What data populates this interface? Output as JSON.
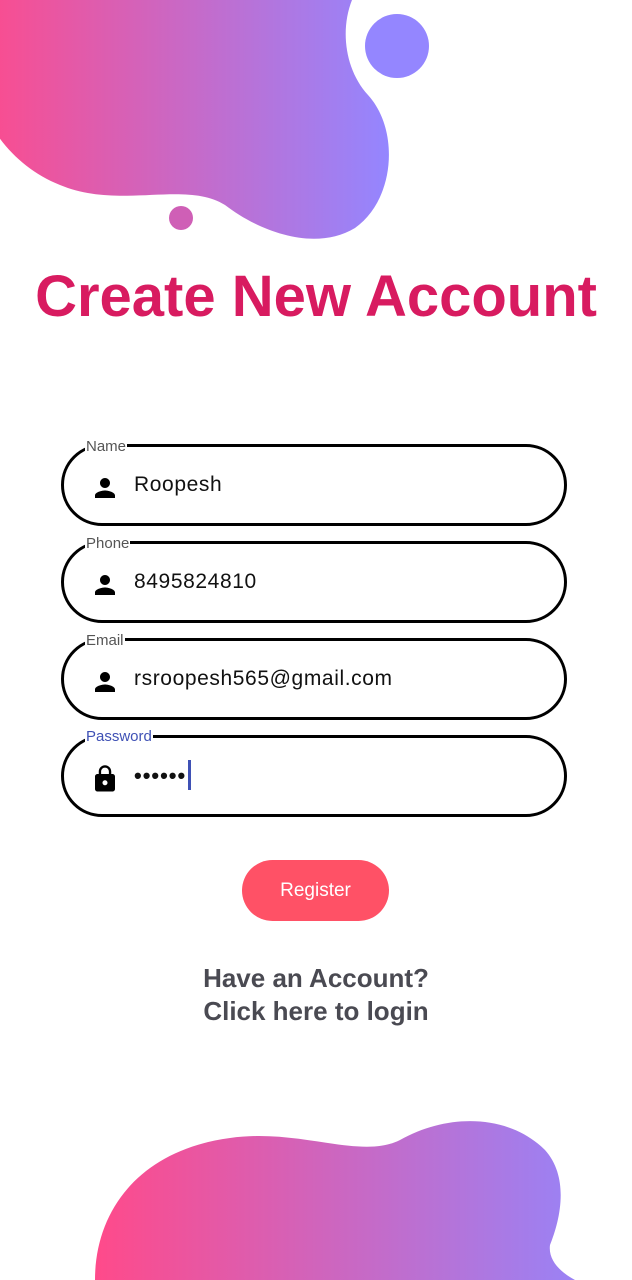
{
  "colors": {
    "title": "#d81b60",
    "blob_gradient_start": "#ff4a8a",
    "blob_gradient_end": "#9486ff",
    "register_button": "#ff5166",
    "focused_label": "#3f51b5"
  },
  "title": "Create New Account",
  "fields": [
    {
      "label": "Name",
      "value": "Roopesh",
      "icon": "person-icon"
    },
    {
      "label": "Phone",
      "value": "8495824810",
      "icon": "person-icon"
    },
    {
      "label": "Email",
      "value": "rsroopesh565@gmail.com",
      "icon": "person-icon"
    },
    {
      "label": "Password",
      "value": "••••••",
      "icon": "lock-icon",
      "focused": true
    }
  ],
  "register_label": "Register",
  "login_link": {
    "line1": "Have an Account?",
    "line2": "Click here to login"
  }
}
